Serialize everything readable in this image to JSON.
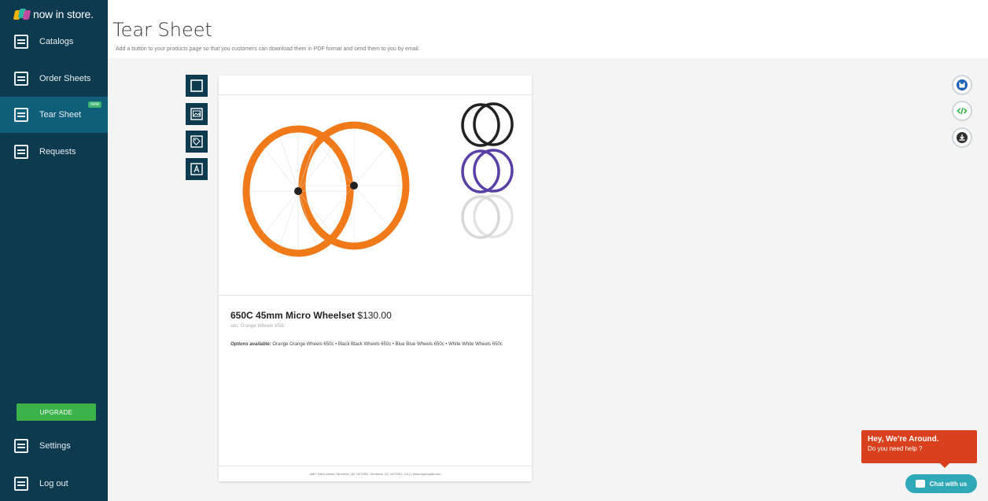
{
  "app": {
    "name": "now in store."
  },
  "sidebar": {
    "items": [
      {
        "label": "Catalogs",
        "icon": "catalog-icon"
      },
      {
        "label": "Order Sheets",
        "icon": "order-sheet-icon"
      },
      {
        "label": "Tear Sheet",
        "icon": "tear-sheet-icon",
        "badge": "new",
        "active": true
      },
      {
        "label": "Requests",
        "icon": "requests-icon"
      }
    ],
    "upgrade_label": "UPGRADE",
    "bottom": [
      {
        "label": "Settings",
        "icon": "tools-icon"
      },
      {
        "label": "Log out",
        "icon": "logout-icon"
      }
    ]
  },
  "header": {
    "title": "Tear Sheet",
    "subtitle": "Add a button to your products page so that you customers can download them in PDF format and send them to you by email."
  },
  "tools": [
    "frame-tool-icon",
    "image-tool-icon",
    "tag-tool-icon",
    "text-tool-icon"
  ],
  "sheet": {
    "product_name": "650C 45mm Micro Wheelset",
    "price": "$130.00",
    "sku": "sku: Orange Wheels 650c",
    "options_label": "Options available:",
    "options_text": "Orange Orange Wheels 650c • Black Black Wheels 650c • Blue Blue Wheels 650c • White White Wheels 650c",
    "footer": "4887 Saint-Urbain, Montreal, QC H2T2W1, Montreal, QC H2T2W1, CA | | www.myshopify.com"
  },
  "actions": [
    "save-icon",
    "embed-code-icon",
    "download-icon"
  ],
  "chat": {
    "title": "Hey, We're Around.",
    "subtitle": "Do you need help ?",
    "button_label": "Chat with us"
  },
  "colors": {
    "sidebar_bg": "#0e3a4f",
    "sidebar_active": "#0f5f7b",
    "upgrade": "#3cb34a",
    "wheel_orange": "#f07a1a",
    "chat_bubble": "#d9411e",
    "chat_button": "#2fa9b8"
  }
}
